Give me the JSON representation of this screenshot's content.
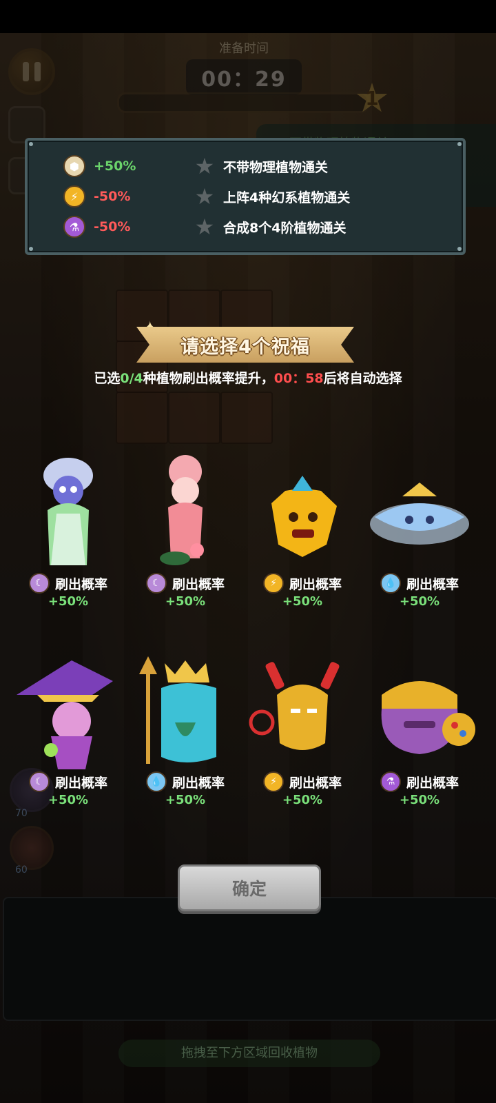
{
  "hud": {
    "timer_title": "准备时间",
    "timer_value": "00：29",
    "stage_number": "1",
    "task_preview": "不带物理植物通关",
    "recycle_hint": "拖拽至下方区域回收植物",
    "skill_counts": [
      "70",
      "60"
    ]
  },
  "blessing_panel": {
    "modifiers": [
      {
        "icon": "physical-icon",
        "value": "+50%",
        "color": "#6bd46b"
      },
      {
        "icon": "lightning-icon",
        "value": "-50%",
        "color": "#ff5a5a"
      },
      {
        "icon": "poison-icon",
        "value": "-50%",
        "color": "#ff5a5a"
      }
    ],
    "quests": [
      {
        "text": "不带物理植物通关"
      },
      {
        "text": "上阵4种幻系植物通关"
      },
      {
        "text": "合成8个4阶植物通关"
      }
    ]
  },
  "title": "请选择4个祝福",
  "subline": {
    "prefix": "已选",
    "selected": "0/4",
    "middle": "种植物刷出概率提升，",
    "countdown": "00：58",
    "suffix": "后将自动选择"
  },
  "cards": [
    {
      "name": "white-haired-plant",
      "element": "phantom-icon",
      "label": "刷出概率",
      "bonus": "+50%"
    },
    {
      "name": "pink-lady-plant",
      "element": "phantom-icon",
      "label": "刷出概率",
      "bonus": "+50%"
    },
    {
      "name": "golden-pepper-plant",
      "element": "lightning-icon",
      "label": "刷出概率",
      "bonus": "+50%"
    },
    {
      "name": "crystal-crown-plant",
      "element": "water-icon",
      "label": "刷出概率",
      "bonus": "+50%"
    },
    {
      "name": "witch-plant",
      "element": "phantom-icon",
      "label": "刷出概率",
      "bonus": "+50%"
    },
    {
      "name": "trident-king-plant",
      "element": "water-icon",
      "label": "刷出概率",
      "bonus": "+50%"
    },
    {
      "name": "armored-hero-plant",
      "element": "lightning-icon",
      "label": "刷出概率",
      "bonus": "+50%"
    },
    {
      "name": "titan-gauntlet-plant",
      "element": "poison-icon",
      "label": "刷出概率",
      "bonus": "+50%"
    }
  ],
  "confirm_label": "确定"
}
